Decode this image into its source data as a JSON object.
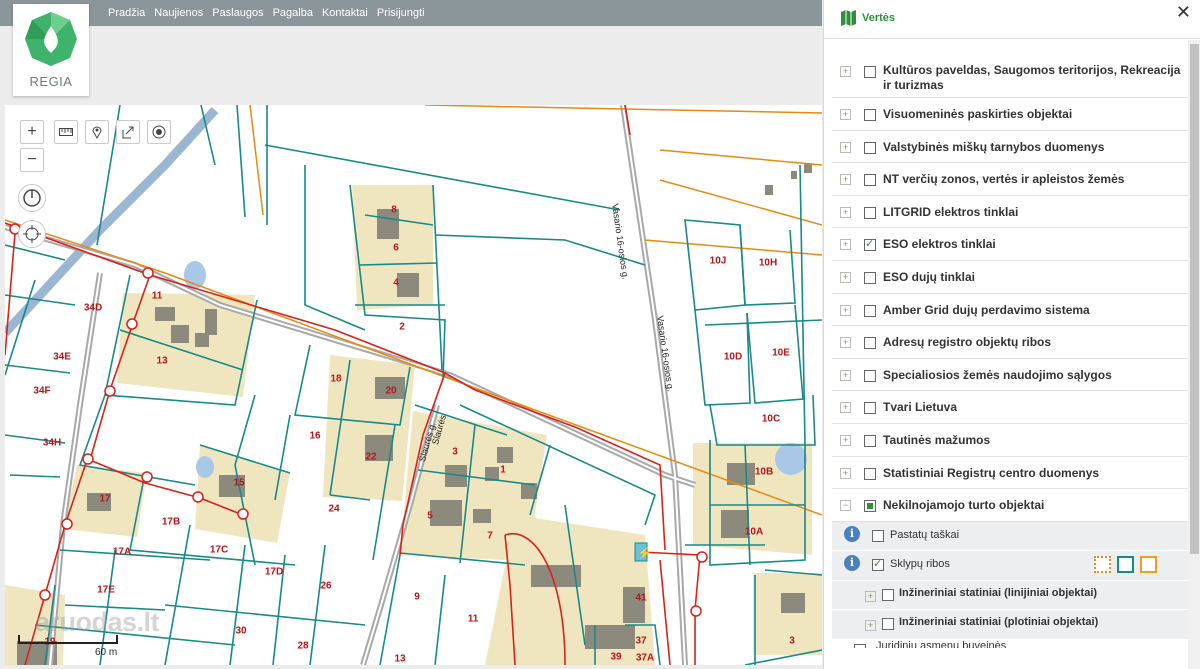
{
  "brand": {
    "logo_text": "REGIA",
    "logo_color": "#3fb36b"
  },
  "nav": [
    "Pradžia",
    "Naujienos",
    "Paslaugos",
    "Pagalba",
    "Kontaktai",
    "Prisijungti"
  ],
  "map": {
    "scale_label": "60 m",
    "watermark": "aruodas.lt",
    "streets": [
      "Vasario 16-osios g.",
      "Vasario 16-osios g.",
      "Slaurės g.",
      "Slaurės"
    ],
    "plot_numbers": [
      "8",
      "6",
      "4",
      "2",
      "10J",
      "10H",
      "10D",
      "10E",
      "10C",
      "10B",
      "10A",
      "34D",
      "34E",
      "34F",
      "34H",
      "11",
      "13",
      "18",
      "20",
      "16",
      "22",
      "3",
      "1",
      "5",
      "7",
      "24",
      "15",
      "17",
      "17B",
      "17A",
      "17C",
      "17D",
      "26",
      "17E",
      "30",
      "28",
      "19",
      "9",
      "11",
      "13",
      "41",
      "37",
      "39",
      "37A",
      "3"
    ],
    "colors": {
      "parcel_boundary": "#178a8a",
      "building_fill": "#efe6c0",
      "power_line": "#d8221b",
      "orange_line": "#e88a10",
      "road": "#a9a9a9"
    }
  },
  "panel": {
    "title": "Vertės",
    "layers": [
      {
        "label": "Kultūros paveldas, Saugomos teritorijos, Rekreacija ir turizmas",
        "checked": "off"
      },
      {
        "label": "Visuomeninės paskirties objektai",
        "checked": "off"
      },
      {
        "label": "Valstybinės miškų tarnybos duomenys",
        "checked": "off"
      },
      {
        "label": "NT verčių zonos, vertės ir apleistos žemės",
        "checked": "off"
      },
      {
        "label": "LITGRID elektros tinklai",
        "checked": "off"
      },
      {
        "label": "ESO elektros tinklai",
        "checked": "on"
      },
      {
        "label": "ESO dujų tinklai",
        "checked": "off"
      },
      {
        "label": "Amber Grid dujų perdavimo sistema",
        "checked": "off"
      },
      {
        "label": "Adresų registro objektų ribos",
        "checked": "off"
      },
      {
        "label": "Specialiosios žemės naudojimo sąlygos",
        "checked": "off"
      },
      {
        "label": "Tvari Lietuva",
        "checked": "off"
      },
      {
        "label": "Tautinės mažumos",
        "checked": "off"
      },
      {
        "label": "Statistiniai Registrų centro duomenys",
        "checked": "off"
      },
      {
        "label": "Nekilnojamojo turto objektai",
        "checked": "partial"
      }
    ],
    "sublayers": [
      {
        "label": "Pastatų taškai",
        "checked": "off"
      },
      {
        "label": "Sklypų ribos",
        "checked": "on"
      }
    ],
    "subsublayers": [
      {
        "label": "Inžineriniai statiniai (linijiniai objektai)",
        "checked": "off"
      },
      {
        "label": "Inžineriniai statiniai (plotiniai objektai)",
        "checked": "off"
      }
    ],
    "cut_off_label": "Juridinių asmenų buveinės",
    "style_swatches": [
      "#e88a10",
      "#178a8a",
      "#f0a020"
    ]
  }
}
